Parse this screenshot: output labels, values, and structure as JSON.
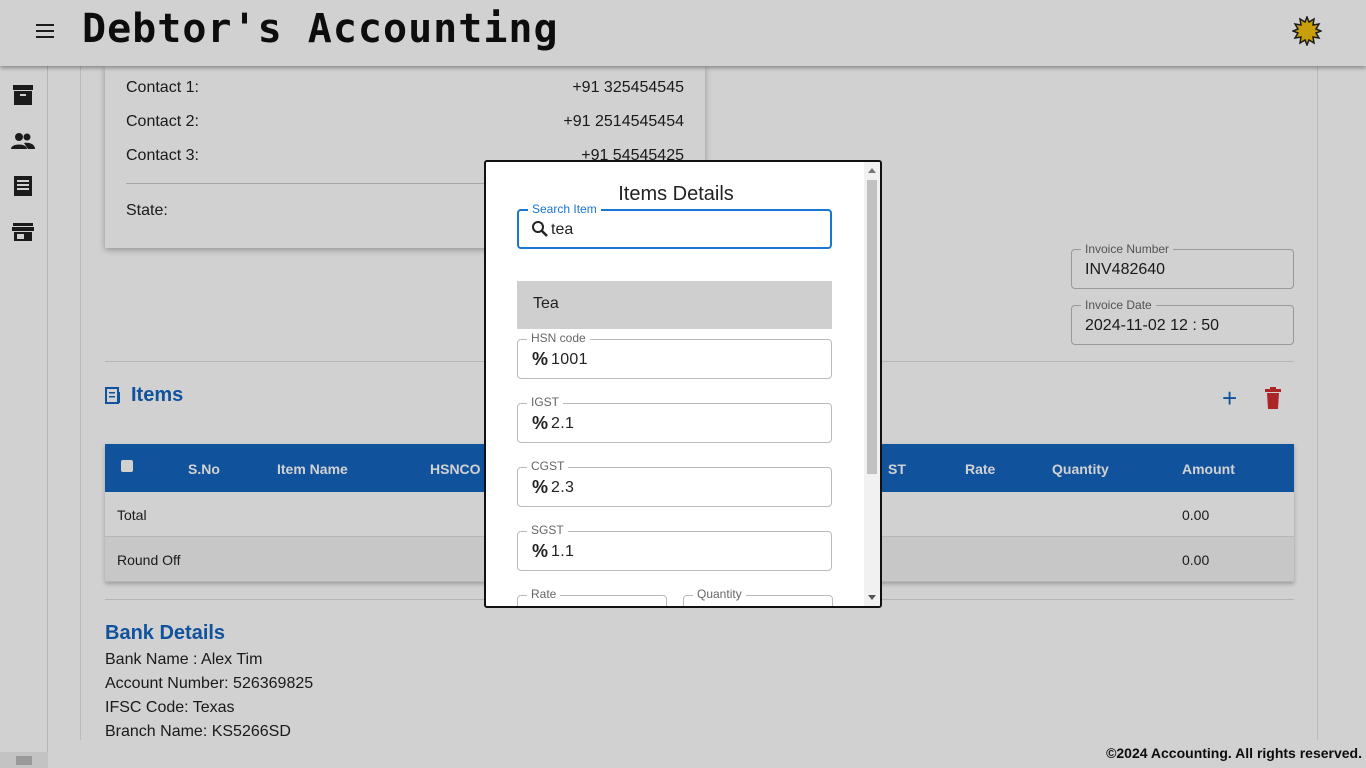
{
  "header": {
    "title": "Debtor's Accounting"
  },
  "sidebar": {
    "items": [
      "archive-icon",
      "people-icon",
      "receipt-icon",
      "store-icon"
    ]
  },
  "contact": {
    "rows": [
      {
        "label": "Contact 1:",
        "value": "+91 325454545"
      },
      {
        "label": "Contact 2:",
        "value": "+91 2514545454"
      },
      {
        "label": "Contact 3:",
        "value": "+91 54545425"
      }
    ],
    "state_label": "State:"
  },
  "invoice": {
    "number_label": "Invoice Number",
    "number": "INV482640",
    "date_label": "Invoice Date",
    "date": "2024-11-02 12 : 50"
  },
  "items_section": {
    "title": "Items",
    "columns": [
      "S.No",
      "Item Name",
      "HSNCO",
      "ST",
      "Rate",
      "Quantity",
      "Amount"
    ],
    "rows": [
      {
        "label": "Total",
        "amount": "0.00"
      },
      {
        "label": "Round Off",
        "amount": "0.00"
      }
    ]
  },
  "bank": {
    "title": "Bank Details",
    "lines": [
      "Bank Name : Alex Tim",
      "Account Number: 526369825",
      "IFSC Code: Texas",
      "Branch Name: KS5266SD"
    ]
  },
  "footer": {
    "text": "©2024 Accounting. All rights reserved."
  },
  "dialog": {
    "title": "Items Details",
    "search_label": "Search Item",
    "search_value": "tea",
    "option": "Tea",
    "fields": [
      {
        "label": "HSN code",
        "value": "1001"
      },
      {
        "label": "IGST",
        "value": "2.1"
      },
      {
        "label": "CGST",
        "value": "2.3"
      },
      {
        "label": "SGST",
        "value": "1.1"
      }
    ],
    "rate_label": "Rate",
    "quantity_label": "Quantity"
  },
  "colors": {
    "primary": "#1565c0",
    "delete": "#d32f2f",
    "accent": "#1976d2"
  }
}
